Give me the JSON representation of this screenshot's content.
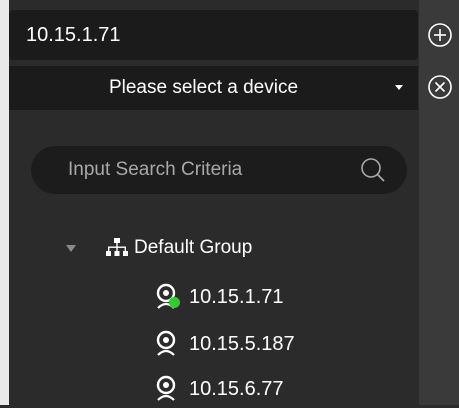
{
  "connection": {
    "ip_value": "10.15.1.71",
    "device_select_value": "Please select a device"
  },
  "search": {
    "placeholder": "Input Search Criteria"
  },
  "tree": {
    "group_label": "Default Group",
    "devices": [
      {
        "label": "10.15.1.71",
        "online": true
      },
      {
        "label": "10.15.5.187",
        "online": false
      },
      {
        "label": "10.15.6.77",
        "online": false
      }
    ]
  },
  "icons": {
    "add": "plus-circle-icon",
    "remove": "x-circle-icon",
    "search": "search-icon",
    "group": "org-tree-icon",
    "device": "camera-icon",
    "expand": "triangle-down-icon"
  },
  "colors": {
    "panel_bg": "#2b2b2b",
    "field_bg": "#1b1b1b",
    "online": "#2ecc2e",
    "placeholder_text": "#a8a8a8"
  }
}
